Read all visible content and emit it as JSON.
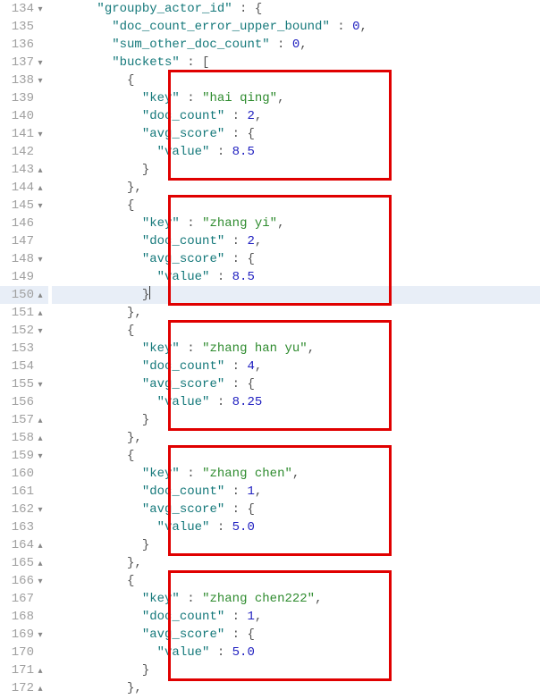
{
  "chart_data": {
    "type": "table",
    "title": "groupby_actor_id aggregation buckets",
    "columns": [
      "key",
      "doc_count",
      "avg_score.value"
    ],
    "rows": [
      [
        "hai qing",
        2,
        8.5
      ],
      [
        "zhang yi",
        2,
        8.5
      ],
      [
        "zhang han yu",
        4,
        8.25
      ],
      [
        "zhang chen",
        1,
        5.0
      ],
      [
        "zhang chen222",
        1,
        5.0
      ]
    ],
    "meta": {
      "doc_count_error_upper_bound": 0,
      "sum_other_doc_count": 0
    }
  },
  "gutter": {
    "lines": [
      {
        "n": "134",
        "f": "▾"
      },
      {
        "n": "135",
        "f": ""
      },
      {
        "n": "136",
        "f": ""
      },
      {
        "n": "137",
        "f": "▾"
      },
      {
        "n": "138",
        "f": "▾"
      },
      {
        "n": "139",
        "f": ""
      },
      {
        "n": "140",
        "f": ""
      },
      {
        "n": "141",
        "f": "▾"
      },
      {
        "n": "142",
        "f": ""
      },
      {
        "n": "143",
        "f": "▴"
      },
      {
        "n": "144",
        "f": "▴"
      },
      {
        "n": "145",
        "f": "▾"
      },
      {
        "n": "146",
        "f": ""
      },
      {
        "n": "147",
        "f": ""
      },
      {
        "n": "148",
        "f": "▾"
      },
      {
        "n": "149",
        "f": ""
      },
      {
        "n": "150",
        "f": "▴"
      },
      {
        "n": "151",
        "f": "▴"
      },
      {
        "n": "152",
        "f": "▾"
      },
      {
        "n": "153",
        "f": ""
      },
      {
        "n": "154",
        "f": ""
      },
      {
        "n": "155",
        "f": "▾"
      },
      {
        "n": "156",
        "f": ""
      },
      {
        "n": "157",
        "f": "▴"
      },
      {
        "n": "158",
        "f": "▴"
      },
      {
        "n": "159",
        "f": "▾"
      },
      {
        "n": "160",
        "f": ""
      },
      {
        "n": "161",
        "f": ""
      },
      {
        "n": "162",
        "f": "▾"
      },
      {
        "n": "163",
        "f": ""
      },
      {
        "n": "164",
        "f": "▴"
      },
      {
        "n": "165",
        "f": "▴"
      },
      {
        "n": "166",
        "f": "▾"
      },
      {
        "n": "167",
        "f": ""
      },
      {
        "n": "168",
        "f": ""
      },
      {
        "n": "169",
        "f": "▾"
      },
      {
        "n": "170",
        "f": ""
      },
      {
        "n": "171",
        "f": "▴"
      },
      {
        "n": "172",
        "f": "▴"
      }
    ]
  },
  "code": {
    "l134a": "\"groupby_actor_id\"",
    "l134b": " : {",
    "l135a": "\"doc_count_error_upper_bound\"",
    "l135b": " : ",
    "l135c": "0",
    "l135d": ",",
    "l136a": "\"sum_other_doc_count\"",
    "l136b": " : ",
    "l136c": "0",
    "l136d": ",",
    "l137a": "\"buckets\"",
    "l137b": " : [",
    "l138": "{",
    "l139a": "\"key\"",
    "l139b": " : ",
    "l139c": "\"hai qing\"",
    "l139d": ",",
    "l140a": "\"doc_count\"",
    "l140b": " : ",
    "l140c": "2",
    "l140d": ",",
    "l141a": "\"avg_score\"",
    "l141b": " : {",
    "l142a": "\"value\"",
    "l142b": " : ",
    "l142c": "8.5",
    "l143": "}",
    "l144": "},",
    "l145": "{",
    "l146a": "\"key\"",
    "l146b": " : ",
    "l146c": "\"zhang yi\"",
    "l146d": ",",
    "l147a": "\"doc_count\"",
    "l147b": " : ",
    "l147c": "2",
    "l147d": ",",
    "l148a": "\"avg_score\"",
    "l148b": " : {",
    "l149a": "\"value\"",
    "l149b": " : ",
    "l149c": "8.5",
    "l150": "}",
    "l151": "},",
    "l152": "{",
    "l153a": "\"key\"",
    "l153b": " : ",
    "l153c": "\"zhang han yu\"",
    "l153d": ",",
    "l154a": "\"doc_count\"",
    "l154b": " : ",
    "l154c": "4",
    "l154d": ",",
    "l155a": "\"avg_score\"",
    "l155b": " : {",
    "l156a": "\"value\"",
    "l156b": " : ",
    "l156c": "8.25",
    "l157": "}",
    "l158": "},",
    "l159": "{",
    "l160a": "\"key\"",
    "l160b": " : ",
    "l160c": "\"zhang chen\"",
    "l160d": ",",
    "l161a": "\"doc_count\"",
    "l161b": " : ",
    "l161c": "1",
    "l161d": ",",
    "l162a": "\"avg_score\"",
    "l162b": " : {",
    "l163a": "\"value\"",
    "l163b": " : ",
    "l163c": "5.0",
    "l164": "}",
    "l165": "},",
    "l166": "{",
    "l167a": "\"key\"",
    "l167b": " : ",
    "l167c": "\"zhang chen222\"",
    "l167d": ",",
    "l168a": "\"doc_count\"",
    "l168b": " : ",
    "l168c": "1",
    "l168d": ",",
    "l169a": "\"avg_score\"",
    "l169b": " : {",
    "l170a": "\"value\"",
    "l170b": " : ",
    "l170c": "5.0",
    "l171": "}",
    "l172": "},"
  },
  "indents": {
    "i3": "      ",
    "i4": "        ",
    "i5": "          ",
    "i6": "            ",
    "i7": "              "
  }
}
